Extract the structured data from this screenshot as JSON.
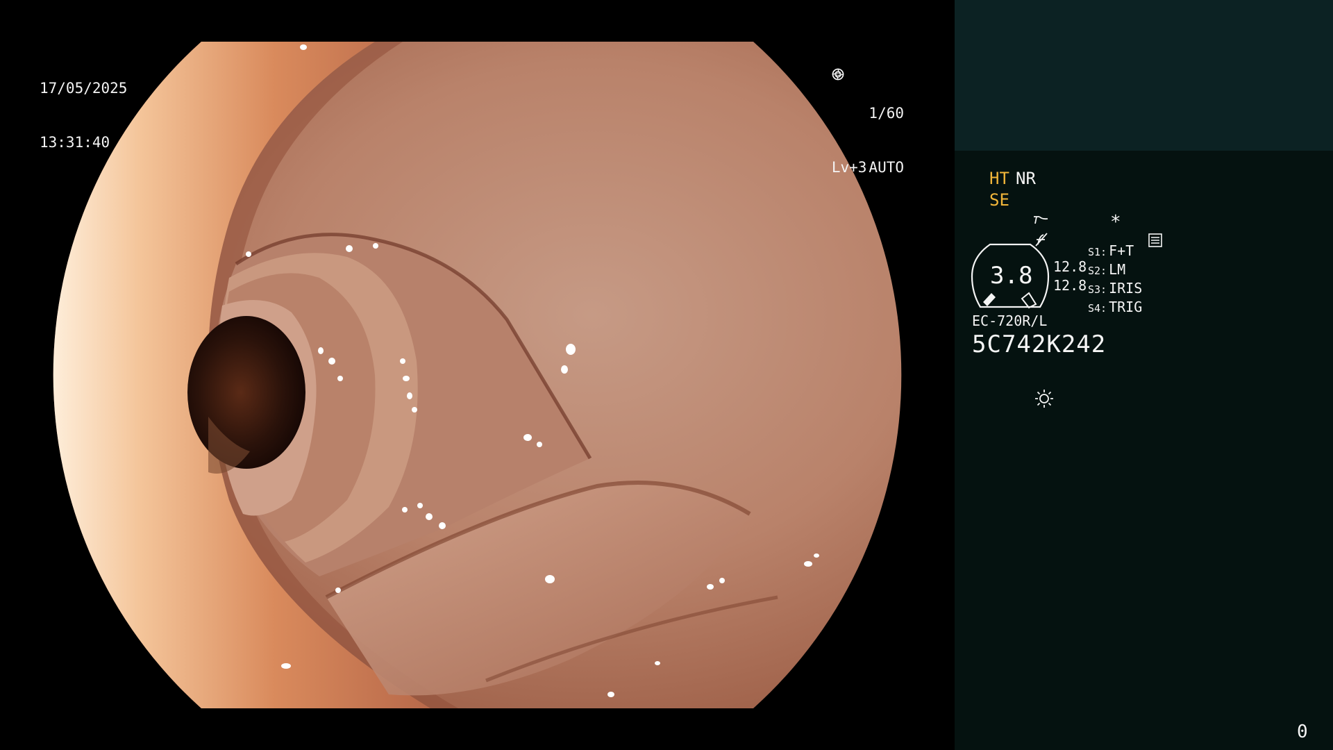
{
  "osd": {
    "date": "17/05/2025",
    "time": "13:31:40",
    "shutter": "1/60",
    "shutter_icon": "aperture-icon",
    "level": "Lv+3",
    "iris_mode": "AUTO",
    "iris_icon": "iris-target-icon"
  },
  "panel": {
    "ht_label": "HT",
    "nr_label": "NR",
    "se_label": "SE",
    "se_icon": "structure-enhancement-icon",
    "zoom_icon": "slash-f-icon",
    "memory_icon": "memory-card-icon",
    "asterisk": "*",
    "gauge_value": "3.8",
    "values": [
      "12.8",
      "12.8"
    ],
    "switches": [
      {
        "key": "S1:",
        "label": "F+T"
      },
      {
        "key": "S2:",
        "label": "LM"
      },
      {
        "key": "S3:",
        "label": "IRIS"
      },
      {
        "key": "S4:",
        "label": "TRIG"
      }
    ],
    "scope_model": "EC-720R/L",
    "scope_serial": "5C742K242",
    "light_icon": "light-sun-icon",
    "frame_counter": "0"
  },
  "colors": {
    "panel_header": "#0c2223",
    "panel_body": "#051210",
    "amber": "#f2b63a",
    "tissue": "#c9927a",
    "lumen": "#2a120a"
  }
}
